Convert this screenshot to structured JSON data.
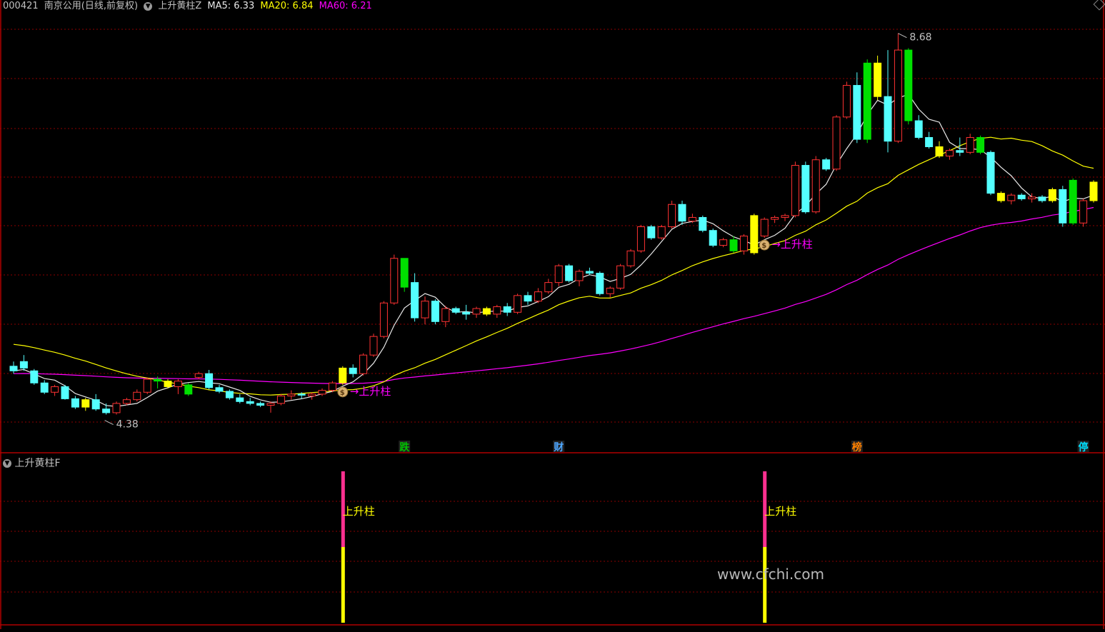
{
  "header": {
    "stock_code": "000421",
    "stock_name": "南京公用(日线,前复权)",
    "indicator_name": "上升黄柱Z",
    "ma5_label": "MA5: 6.33",
    "ma20_label": "MA20: 6.84",
    "ma60_label": "MA60: 6.21"
  },
  "sub_panel": {
    "title": "上升黄柱F",
    "signal_label": "上升柱"
  },
  "main_chart": {
    "high_label": "8.68",
    "low_label": "4.38",
    "signal_arrow_label": "上升柱",
    "event_markers": [
      {
        "text": "跌",
        "color": "#00c000",
        "bar": 38
      },
      {
        "text": "财",
        "color": "#4da6ff",
        "bar": 53
      },
      {
        "text": "榜",
        "color": "#ff8000",
        "bar": 82
      },
      {
        "text": "停",
        "color": "#00e0ff",
        "bar": 104
      }
    ],
    "signal_bars": [
      32,
      73
    ]
  },
  "watermark": "www.cfchi.com",
  "colors": {
    "up": "#ff3232",
    "down": "#54ffff",
    "yellow_bar": "#ffff00",
    "green_bar": "#00e000",
    "ma5": "#e8e8e8",
    "ma20": "#ffff00",
    "ma60": "#ff00ff",
    "grid": "#8b0000",
    "signal_pink": "#ff3090"
  },
  "chart_data": {
    "type": "candlestick",
    "price_range": [
      4.2,
      8.9
    ],
    "candles": [
      [
        5.1,
        5.15,
        5.02,
        5.05
      ],
      [
        5.15,
        5.22,
        5.05,
        5.08
      ],
      [
        5.05,
        5.07,
        4.9,
        4.92
      ],
      [
        4.92,
        4.95,
        4.8,
        4.82
      ],
      [
        4.82,
        4.9,
        4.78,
        4.88
      ],
      [
        4.88,
        4.9,
        4.74,
        4.75
      ],
      [
        4.75,
        4.78,
        4.64,
        4.66
      ],
      [
        4.66,
        4.76,
        4.62,
        4.74
      ],
      [
        4.74,
        4.8,
        4.62,
        4.64
      ],
      [
        4.64,
        4.7,
        4.58,
        4.6
      ],
      [
        4.6,
        4.72,
        4.58,
        4.7
      ],
      [
        4.7,
        4.76,
        4.68,
        4.74
      ],
      [
        4.74,
        4.85,
        4.72,
        4.82
      ],
      [
        4.82,
        4.98,
        4.8,
        4.96
      ],
      [
        4.96,
        4.99,
        4.86,
        4.94
      ],
      [
        4.94,
        4.96,
        4.86,
        4.88
      ],
      [
        4.88,
        4.96,
        4.8,
        4.94
      ],
      [
        4.8,
        4.92,
        4.78,
        4.9
      ],
      [
        4.98,
        5.04,
        4.96,
        5.02
      ],
      [
        5.02,
        5.06,
        4.85,
        4.87
      ],
      [
        4.87,
        4.9,
        4.81,
        4.83
      ],
      [
        4.83,
        4.85,
        4.74,
        4.76
      ],
      [
        4.76,
        4.8,
        4.7,
        4.72
      ],
      [
        4.72,
        4.76,
        4.68,
        4.7
      ],
      [
        4.7,
        4.72,
        4.66,
        4.68
      ],
      [
        4.68,
        4.72,
        4.6,
        4.7
      ],
      [
        4.7,
        4.8,
        4.68,
        4.78
      ],
      [
        4.78,
        4.84,
        4.74,
        4.8
      ],
      [
        4.8,
        4.82,
        4.75,
        4.79
      ],
      [
        4.78,
        4.82,
        4.74,
        4.8
      ],
      [
        4.8,
        4.86,
        4.78,
        4.84
      ],
      [
        4.84,
        4.94,
        4.82,
        4.92
      ],
      [
        4.92,
        5.1,
        4.9,
        5.08
      ],
      [
        5.08,
        5.12,
        4.98,
        5.02
      ],
      [
        5.02,
        5.24,
        5.0,
        5.22
      ],
      [
        5.22,
        5.45,
        5.2,
        5.42
      ],
      [
        5.42,
        5.8,
        5.4,
        5.78
      ],
      [
        5.78,
        6.3,
        5.76,
        6.26
      ],
      [
        6.26,
        6.26,
        5.9,
        5.95
      ],
      [
        6.0,
        6.1,
        5.58,
        5.62
      ],
      [
        5.62,
        5.85,
        5.55,
        5.8
      ],
      [
        5.8,
        5.82,
        5.55,
        5.58
      ],
      [
        5.58,
        5.75,
        5.52,
        5.72
      ],
      [
        5.72,
        5.74,
        5.66,
        5.68
      ],
      [
        5.68,
        5.76,
        5.6,
        5.66
      ],
      [
        5.66,
        5.74,
        5.62,
        5.72
      ],
      [
        5.72,
        5.74,
        5.64,
        5.66
      ],
      [
        5.66,
        5.76,
        5.62,
        5.74
      ],
      [
        5.74,
        5.78,
        5.64,
        5.68
      ],
      [
        5.68,
        5.88,
        5.66,
        5.86
      ],
      [
        5.86,
        5.9,
        5.76,
        5.8
      ],
      [
        5.8,
        5.94,
        5.78,
        5.9
      ],
      [
        5.9,
        6.04,
        5.88,
        6.0
      ],
      [
        6.0,
        6.2,
        5.96,
        6.18
      ],
      [
        6.18,
        6.2,
        6.0,
        6.02
      ],
      [
        6.02,
        6.14,
        5.96,
        6.12
      ],
      [
        6.12,
        6.16,
        6.08,
        6.1
      ],
      [
        6.1,
        6.12,
        5.86,
        5.88
      ],
      [
        5.88,
        5.96,
        5.84,
        5.94
      ],
      [
        5.94,
        6.2,
        5.92,
        6.18
      ],
      [
        6.18,
        6.36,
        6.16,
        6.34
      ],
      [
        6.34,
        6.62,
        6.32,
        6.6
      ],
      [
        6.6,
        6.62,
        6.46,
        6.48
      ],
      [
        6.48,
        6.62,
        6.46,
        6.6
      ],
      [
        6.6,
        6.88,
        6.58,
        6.84
      ],
      [
        6.84,
        6.88,
        6.62,
        6.66
      ],
      [
        6.66,
        6.74,
        6.64,
        6.7
      ],
      [
        6.7,
        6.72,
        6.54,
        6.56
      ],
      [
        6.56,
        6.58,
        6.38,
        6.4
      ],
      [
        6.4,
        6.48,
        6.38,
        6.46
      ],
      [
        6.46,
        6.5,
        6.32,
        6.34
      ],
      [
        6.34,
        6.52,
        6.3,
        6.5
      ],
      [
        6.72,
        6.74,
        6.3,
        6.32
      ],
      [
        6.5,
        6.7,
        6.48,
        6.68
      ],
      [
        6.68,
        6.72,
        6.64,
        6.7
      ],
      [
        6.7,
        6.74,
        6.66,
        6.72
      ],
      [
        6.72,
        7.3,
        6.7,
        7.26
      ],
      [
        7.26,
        7.3,
        6.74,
        6.76
      ],
      [
        6.76,
        7.36,
        6.74,
        7.32
      ],
      [
        7.32,
        7.34,
        7.2,
        7.22
      ],
      [
        7.22,
        7.8,
        7.2,
        7.78
      ],
      [
        7.78,
        8.16,
        7.76,
        8.12
      ],
      [
        8.12,
        8.26,
        7.5,
        7.54
      ],
      [
        7.54,
        8.4,
        7.5,
        8.36
      ],
      [
        8.36,
        8.44,
        7.96,
        8.0
      ],
      [
        8.0,
        8.5,
        7.4,
        7.52
      ],
      [
        7.52,
        8.68,
        7.5,
        8.5
      ],
      [
        8.5,
        8.52,
        7.7,
        7.74
      ],
      [
        7.74,
        7.8,
        7.54,
        7.56
      ],
      [
        7.56,
        7.62,
        7.44,
        7.46
      ],
      [
        7.46,
        7.52,
        7.34,
        7.36
      ],
      [
        7.36,
        7.44,
        7.32,
        7.42
      ],
      [
        7.42,
        7.56,
        7.36,
        7.4
      ],
      [
        7.4,
        7.6,
        7.38,
        7.56
      ],
      [
        7.56,
        7.58,
        7.38,
        7.4
      ],
      [
        7.4,
        7.42,
        6.94,
        6.96
      ],
      [
        6.96,
        6.98,
        6.86,
        6.88
      ],
      [
        6.88,
        6.96,
        6.84,
        6.94
      ],
      [
        6.94,
        6.96,
        6.88,
        6.9
      ],
      [
        6.9,
        6.96,
        6.86,
        6.92
      ],
      [
        6.92,
        6.94,
        6.86,
        6.88
      ],
      [
        6.88,
        7.02,
        6.86,
        7.0
      ],
      [
        7.0,
        7.04,
        6.6,
        6.64
      ],
      [
        6.64,
        7.12,
        6.62,
        7.1
      ],
      [
        6.64,
        6.9,
        6.6,
        6.88
      ],
      [
        6.88,
        7.1,
        6.86,
        7.08
      ]
    ]
  }
}
